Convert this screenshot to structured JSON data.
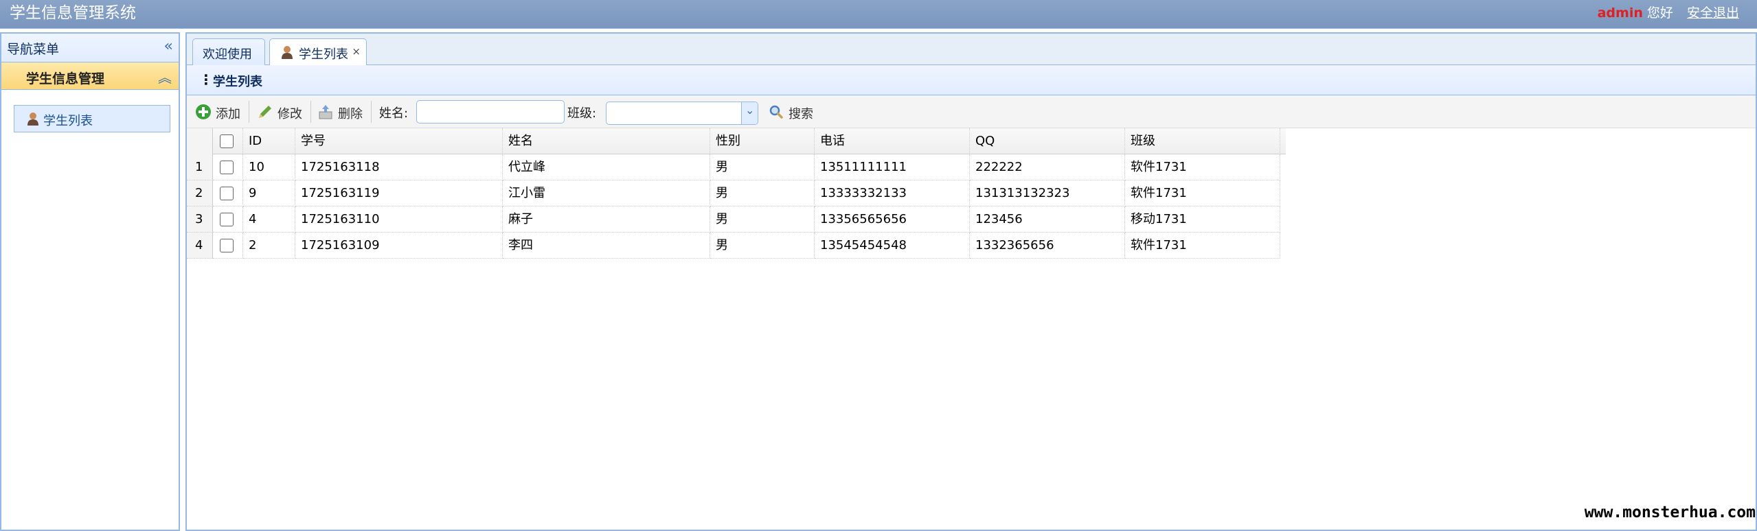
{
  "header": {
    "title": "学生信息管理系统",
    "admin_name": "admin",
    "greeting": "您好",
    "logout_label": "安全退出"
  },
  "west": {
    "panel_title": "导航菜单",
    "collapse_icon": "double-chevron-left-icon",
    "group_title": "学生信息管理",
    "group_collapse_icon": "double-chevron-up-icon",
    "menu_item_label": "学生列表",
    "menu_item_icon": "user-icon"
  },
  "tabs": [
    {
      "label": "欢迎使用"
    },
    {
      "label": "学生列表",
      "icon": "user-icon",
      "closable": "×"
    }
  ],
  "subpanel": {
    "title": "学生列表"
  },
  "toolbar": {
    "add_label": "添加",
    "edit_label": "修改",
    "delete_label": "删除",
    "name_label": "姓名:",
    "name_value": "",
    "class_label": "班级:",
    "class_value": "",
    "search_label": "搜索"
  },
  "grid": {
    "columns": [
      "ID",
      "学号",
      "姓名",
      "性别",
      "电话",
      "QQ",
      "班级"
    ],
    "rows": [
      {
        "num": "1",
        "id": "10",
        "sno": "1725163118",
        "name": "代立峰",
        "sex": "男",
        "phone": "13511111111",
        "qq": "222222",
        "clazz": "软件1731"
      },
      {
        "num": "2",
        "id": "9",
        "sno": "1725163119",
        "name": "江小雷",
        "sex": "男",
        "phone": "13333332133",
        "qq": "131313132323",
        "clazz": "软件1731"
      },
      {
        "num": "3",
        "id": "4",
        "sno": "1725163110",
        "name": "麻子",
        "sex": "男",
        "phone": "13356565656",
        "qq": "123456",
        "clazz": "移动1731"
      },
      {
        "num": "4",
        "id": "2",
        "sno": "1725163109",
        "name": "李四",
        "sex": "男",
        "phone": "13545454548",
        "qq": "1332365656",
        "clazz": "软件1731"
      }
    ]
  },
  "watermark": "www.monsterhua.com"
}
